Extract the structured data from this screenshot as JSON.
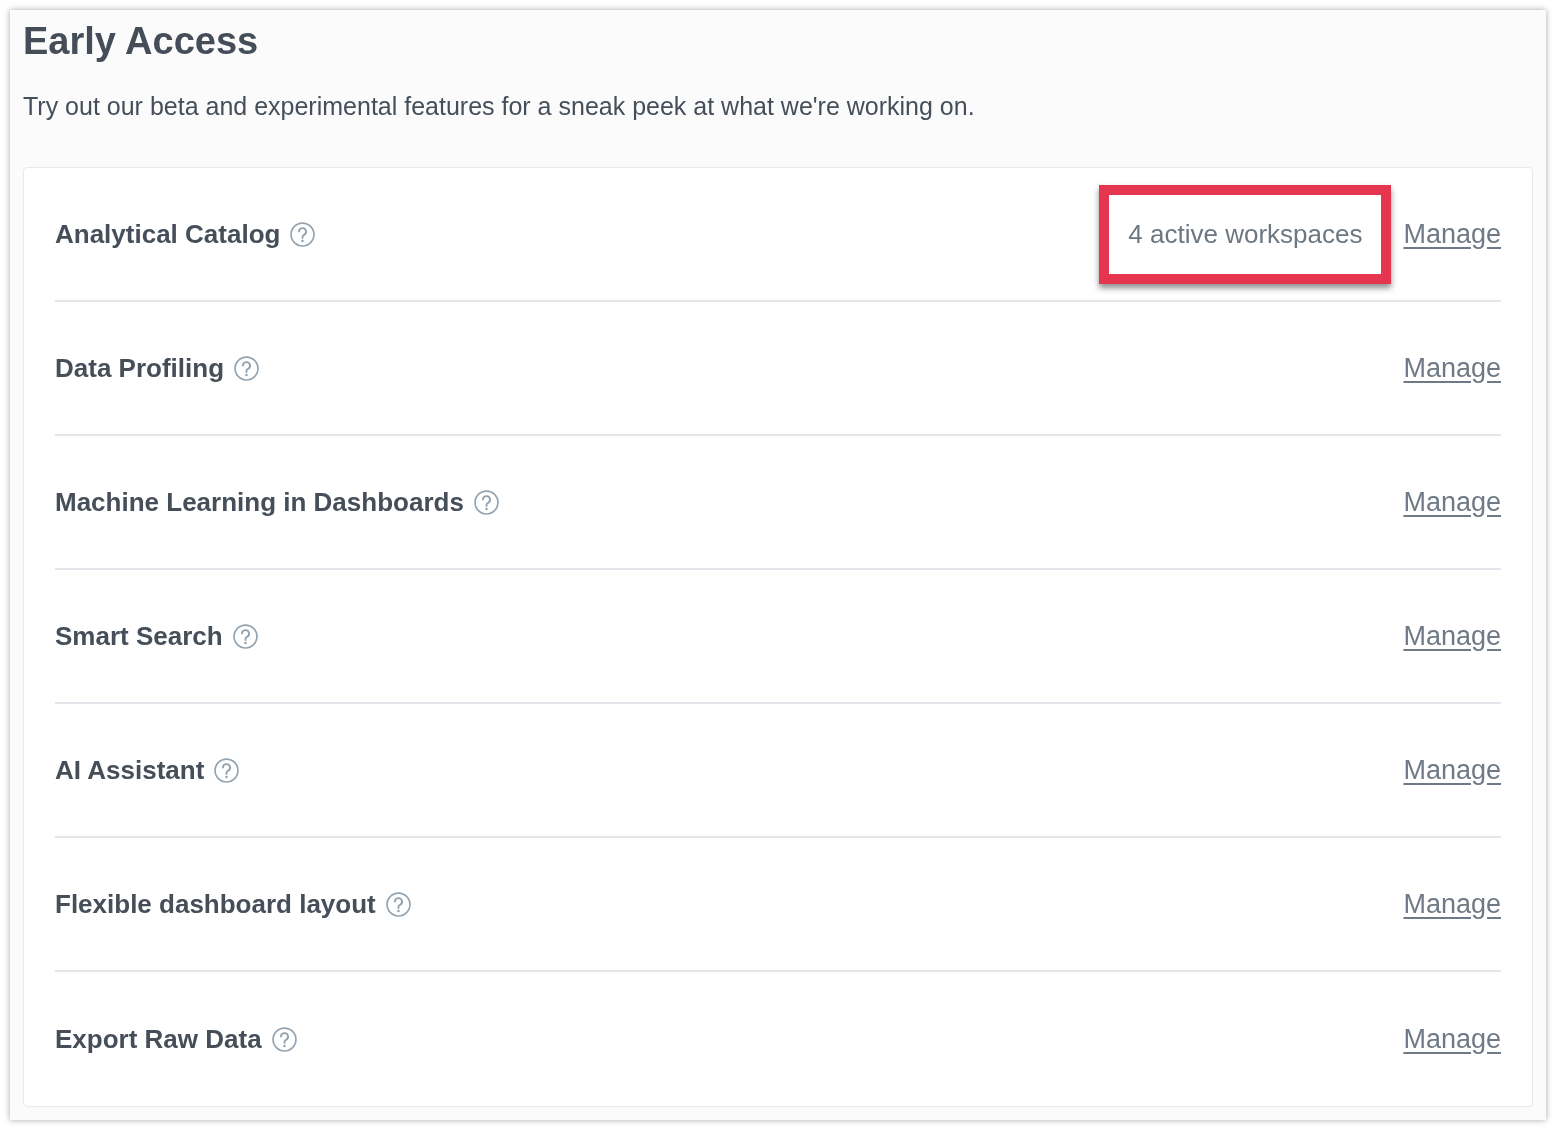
{
  "page": {
    "title": "Early Access",
    "description": "Try out our beta and experimental features for a sneak peek at what we're working on."
  },
  "features": [
    {
      "name": "Analytical Catalog",
      "status": {
        "text": "4 active workspaces",
        "highlighted": true
      },
      "link": "Manage"
    },
    {
      "name": "Data Profiling",
      "link": "Manage"
    },
    {
      "name": "Machine Learning in Dashboards",
      "link": "Manage"
    },
    {
      "name": "Smart Search",
      "link": "Manage"
    },
    {
      "name": "AI Assistant",
      "link": "Manage"
    },
    {
      "name": "Flexible dashboard layout",
      "link": "Manage"
    },
    {
      "name": "Export Raw Data",
      "link": "Manage"
    }
  ]
}
